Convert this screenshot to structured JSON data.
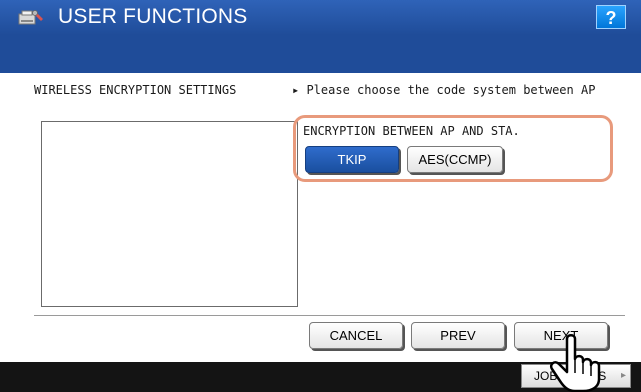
{
  "header": {
    "title": "USER FUNCTIONS",
    "help_label": "?",
    "app_icon": "printer-wrench-icon"
  },
  "section": {
    "title": "WIRELESS ENCRYPTION SETTINGS",
    "instruction": "▸ Please choose the code system between AP"
  },
  "encryption": {
    "label": "ENCRYPTION BETWEEN AP AND STA.",
    "options": [
      "TKIP",
      "AES(CCMP)"
    ],
    "selected": "TKIP"
  },
  "footer": {
    "cancel_label": "CANCEL",
    "prev_label": "PREV",
    "next_label": "NEXT"
  },
  "statusbar": {
    "job_status_label": "JOB STATUS",
    "pointer_icon": "hand-pointer-icon"
  },
  "colors": {
    "header_blue": "#1f4c99",
    "selected_blue": "#1a4f9f",
    "highlight_ring": "#e89a7c"
  }
}
